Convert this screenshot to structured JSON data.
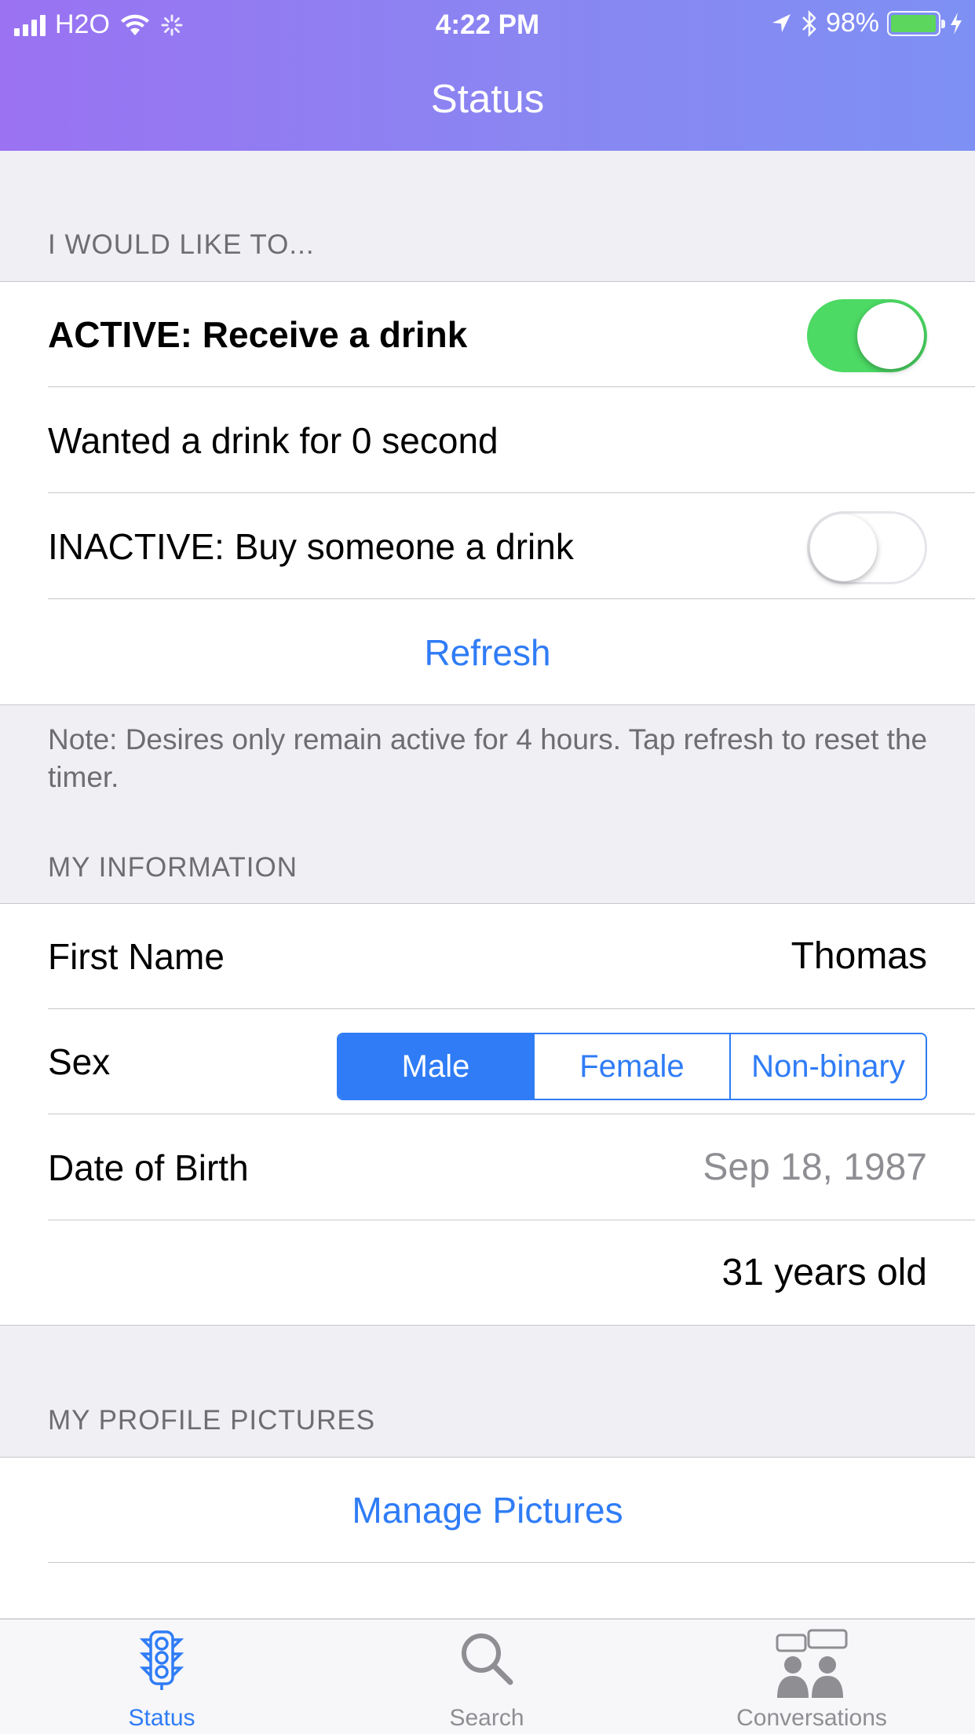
{
  "status_bar": {
    "carrier": "H2O",
    "time": "4:22 PM",
    "battery_percent": "98%",
    "battery_level": 0.98
  },
  "nav": {
    "title": "Status"
  },
  "sections": {
    "desires": {
      "header": "I WOULD LIKE TO...",
      "active_label": "ACTIVE: Receive a drink",
      "active_toggle_on": true,
      "wanted_text": "Wanted a drink for 0 second",
      "inactive_label": "INACTIVE: Buy someone a drink",
      "inactive_toggle_on": false,
      "refresh_label": "Refresh",
      "note": "Note: Desires only remain active for 4 hours. Tap refresh to reset the timer."
    },
    "info": {
      "header": "MY INFORMATION",
      "first_name_label": "First Name",
      "first_name_value": "Thomas",
      "sex_label": "Sex",
      "sex_options": [
        "Male",
        "Female",
        "Non-binary"
      ],
      "sex_selected": "Male",
      "dob_label": "Date of Birth",
      "dob_value": "Sep 18, 1987",
      "age_text": "31 years old"
    },
    "pictures": {
      "header": "MY PROFILE PICTURES",
      "manage_label": "Manage Pictures"
    }
  },
  "tabs": [
    {
      "label": "Status",
      "icon": "traffic-light-icon",
      "active": true
    },
    {
      "label": "Search",
      "icon": "search-icon",
      "active": false
    },
    {
      "label": "Conversations",
      "icon": "conversations-icon",
      "active": false
    }
  ],
  "colors": {
    "accent": "#2f7cf6",
    "toggle_on": "#4cd964",
    "header_gradient_start": "#9a72f2",
    "header_gradient_end": "#7e90f3"
  }
}
